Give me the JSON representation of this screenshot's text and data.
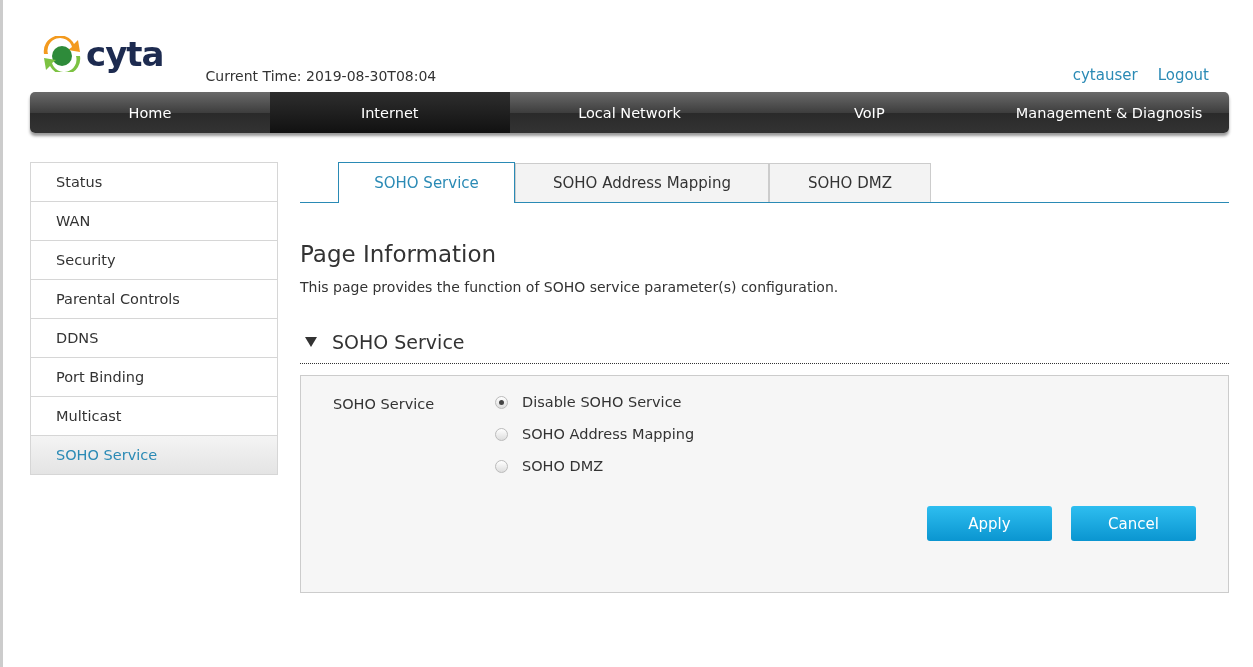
{
  "header": {
    "logo_text": "cyta",
    "current_time": "Current Time: 2019-08-30T08:04",
    "user": "cytauser",
    "logout": "Logout"
  },
  "nav": [
    {
      "label": "Home",
      "selected": false
    },
    {
      "label": "Internet",
      "selected": true
    },
    {
      "label": "Local Network",
      "selected": false
    },
    {
      "label": "VoIP",
      "selected": false
    },
    {
      "label": "Management & Diagnosis",
      "selected": false
    }
  ],
  "sidebar": {
    "items": [
      {
        "label": "Status",
        "selected": false
      },
      {
        "label": "WAN",
        "selected": false
      },
      {
        "label": "Security",
        "selected": false
      },
      {
        "label": "Parental Controls",
        "selected": false
      },
      {
        "label": "DDNS",
        "selected": false
      },
      {
        "label": "Port Binding",
        "selected": false
      },
      {
        "label": "Multicast",
        "selected": false
      },
      {
        "label": "SOHO Service",
        "selected": true
      }
    ]
  },
  "tabs": [
    {
      "label": "SOHO Service",
      "selected": true
    },
    {
      "label": "SOHO Address Mapping",
      "selected": false
    },
    {
      "label": "SOHO DMZ",
      "selected": false
    }
  ],
  "page_info": {
    "title": "Page Information",
    "description": "This page provides the function of SOHO service parameter(s) configuration."
  },
  "section": {
    "title": "SOHO Service",
    "expanded": true,
    "field_label": "SOHO Service",
    "options": [
      {
        "label": "Disable SOHO Service",
        "selected": true
      },
      {
        "label": "SOHO Address Mapping",
        "selected": false
      },
      {
        "label": "SOHO DMZ",
        "selected": false
      }
    ]
  },
  "buttons": [
    "Apply",
    "Cancel"
  ]
}
